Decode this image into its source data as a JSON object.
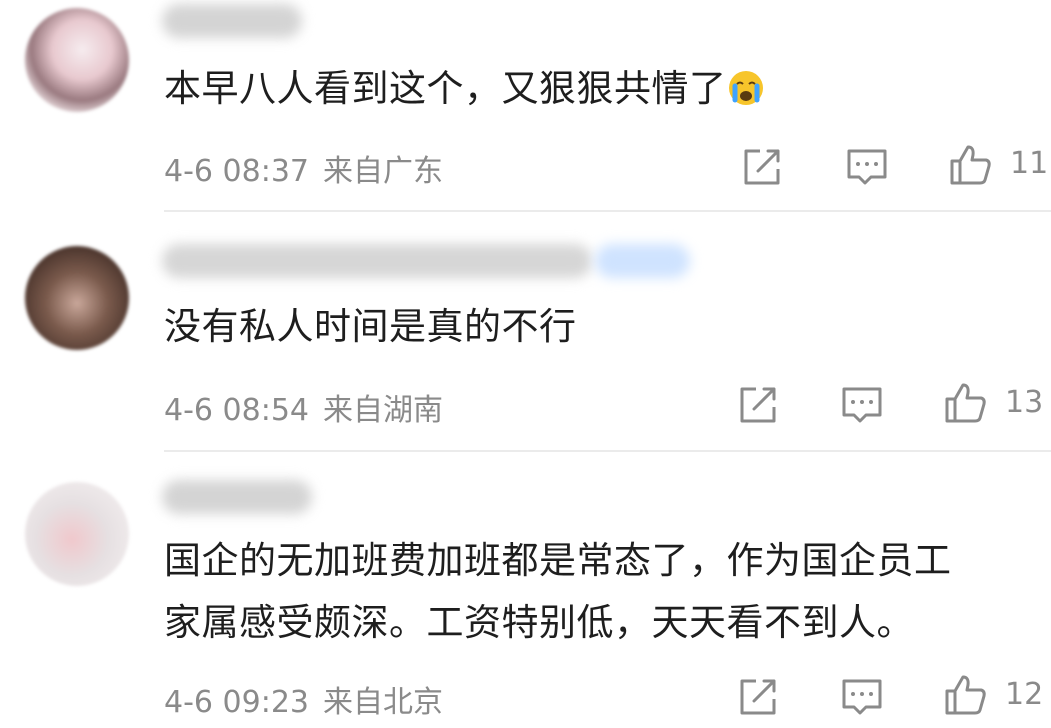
{
  "comments": [
    {
      "text_lines": [
        "本早八人看到这个，又狠狠共情了"
      ],
      "emoji": "crying-face-emoji",
      "date": "4-6 08:37",
      "location": "来自广东",
      "likes": "11"
    },
    {
      "text_lines": [
        "没有私人时间是真的不行"
      ],
      "date": "4-6 08:54",
      "location": "来自湖南",
      "likes": "13"
    },
    {
      "text_lines": [
        "国企的无加班费加班都是常态了，作为国企员工",
        "家属感受颇深。工资特别低，天天看不到人。"
      ],
      "date": "4-6 09:23",
      "location": "来自北京",
      "likes": "12"
    }
  ],
  "colors": {
    "text": "#1e1e1e",
    "meta": "#8a8a8a",
    "icon": "#8a8a8a",
    "divider": "#ebebeb",
    "verified_badge": "#cfe3ff"
  }
}
